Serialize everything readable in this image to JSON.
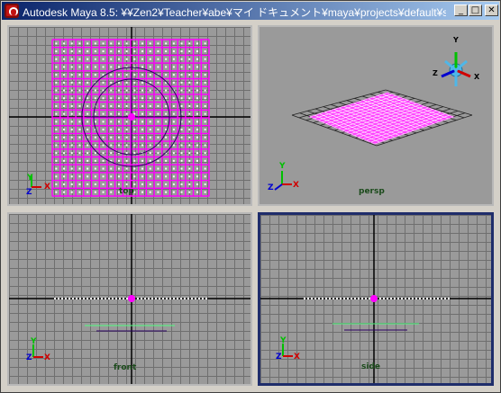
{
  "window": {
    "title": "Autodesk Maya 8.5: ¥¥Zen2¥Teacher¥abe¥マイ ドキュメント¥maya¥projects¥default¥scenes¥c...",
    "minimize_glyph": "_",
    "maximize_glyph": "□",
    "close_glyph": "✕"
  },
  "viewports": {
    "top": {
      "label": "top"
    },
    "persp": {
      "label": "persp"
    },
    "front": {
      "label": "front"
    },
    "side": {
      "label": "side"
    }
  },
  "axes": {
    "x": "X",
    "y": "Y",
    "z": "Z"
  },
  "colors": {
    "mesh": "#ff00ff",
    "grid_line": "#6f6f6f",
    "axis_x": "#d00000",
    "axis_y": "#00c000",
    "axis_z": "#0000d0",
    "active_border": "#1f2d6b"
  }
}
